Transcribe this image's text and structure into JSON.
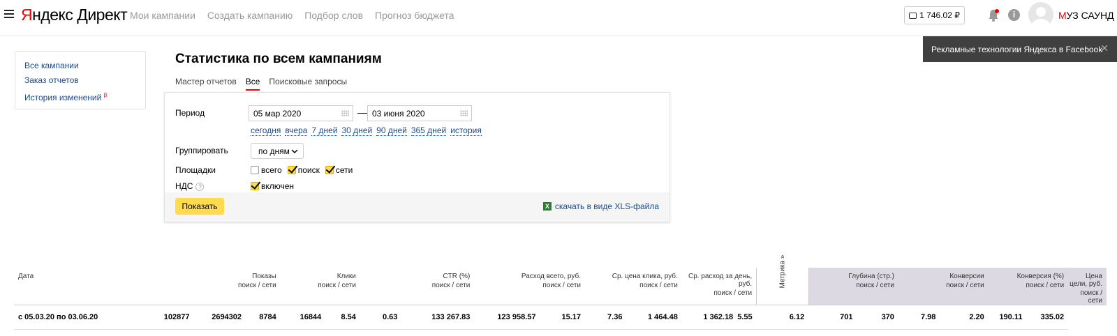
{
  "header": {
    "logo_y": "Я",
    "logo_rest": "ндекс Директ",
    "nav": [
      "Мои кампании",
      "Создать кампанию",
      "Подбор слов",
      "Прогноз бюджета"
    ],
    "balance": "1 746.02 ₽",
    "user_first": "М",
    "user_rest": "УЗ САУНД"
  },
  "sidebar": {
    "items": [
      "Все кампании",
      "Заказ отчетов",
      "История изменений"
    ],
    "beta": "β"
  },
  "page": {
    "title": "Статистика по всем кампаниям",
    "tabs": [
      "Мастер отчетов",
      "Все",
      "Поисковые запросы"
    ],
    "active_tab": "Все"
  },
  "form": {
    "period_label": "Период",
    "date_from": "05 мар 2020",
    "date_to": "03 июня 2020",
    "dash": "—",
    "quick_links": [
      "сегодня",
      "вчера",
      "7 дней",
      "30 дней",
      "90 дней",
      "365 дней",
      "история"
    ],
    "group_label": "Группировать",
    "group_value": "по дням",
    "sites_label": "Площадки",
    "sites": [
      {
        "label": "всего",
        "checked": false
      },
      {
        "label": "поиск",
        "checked": true
      },
      {
        "label": "сети",
        "checked": true
      }
    ],
    "vat_label": "НДС",
    "vat_help": "?",
    "vat_option": "включен",
    "show_button": "Показать",
    "xls_link": "скачать в виде XLS-файла"
  },
  "toast": {
    "text": "Рекламные технологии Яндекса в Facebook",
    "close": "✕"
  },
  "table": {
    "headers": [
      {
        "title": "Дата",
        "sub": ""
      },
      {
        "title": "Показы",
        "sub": "поиск / сети"
      },
      {
        "title": "Клики",
        "sub": "поиск / сети"
      },
      {
        "title": "CTR (%)",
        "sub": "поиск / сети"
      },
      {
        "title": "Расход всего, руб.",
        "sub": "поиск / сети"
      },
      {
        "title": "Ср. цена клика, руб.",
        "sub": "поиск / сети"
      },
      {
        "title": "Ср. расход за день, руб.",
        "sub": "поиск / сети"
      },
      {
        "title": "Глубина (стр.)",
        "sub": "поиск / сети"
      },
      {
        "title": "Конверсии",
        "sub": "поиск / сети"
      },
      {
        "title": "Конверсия (%)",
        "sub": "поиск / сети"
      },
      {
        "title": "Цена цели, руб.",
        "sub": "поиск / сети"
      }
    ],
    "metrika_label": "Метрика »",
    "row": {
      "date": "с 05.03.20 по 03.06.20",
      "values": [
        "102877",
        "2694302",
        "8784",
        "16844",
        "8.54",
        "0.63",
        "133 267.83",
        "123 958.57",
        "15.17",
        "7.36",
        "1 464.48",
        "1 362.18"
      ],
      "metrika_values": [
        "5.55",
        "6.12",
        "701",
        "370",
        "7.98",
        "2.20",
        "190.11",
        "335.02"
      ]
    }
  }
}
